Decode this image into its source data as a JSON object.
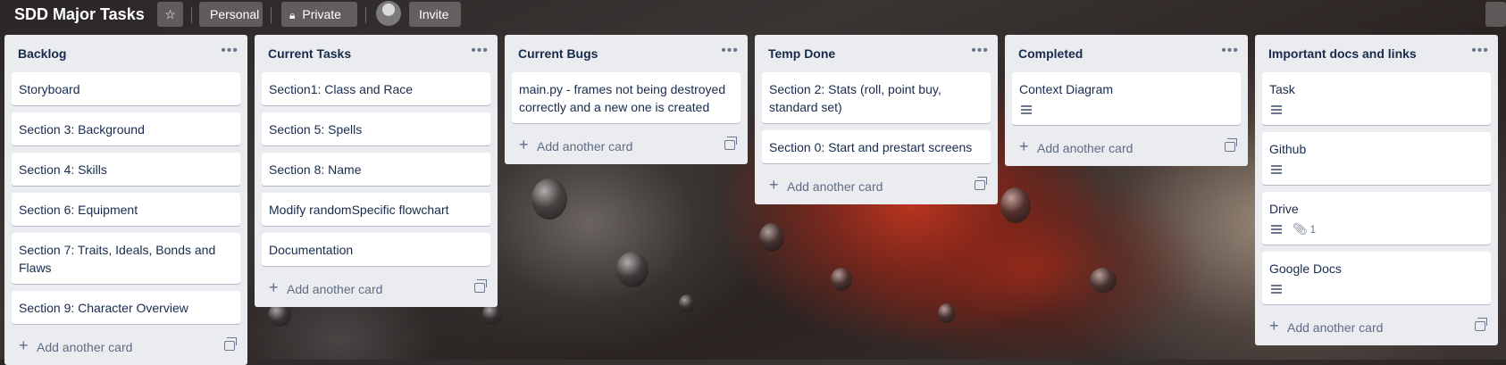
{
  "board": {
    "title": "SDD Major Tasks",
    "visibility_team": "Personal",
    "visibility_privacy": "Private",
    "invite_label": "Invite"
  },
  "add_card_label": "Add another card",
  "lists": [
    {
      "title": "Backlog",
      "cards": [
        {
          "title": "Storyboard"
        },
        {
          "title": "Section 3: Background"
        },
        {
          "title": "Section 4: Skills"
        },
        {
          "title": "Section 6: Equipment"
        },
        {
          "title": "Section 7: Traits, Ideals, Bonds and Flaws"
        },
        {
          "title": "Section 9: Character Overview"
        }
      ]
    },
    {
      "title": "Current Tasks",
      "cards": [
        {
          "title": "Section1: Class and Race"
        },
        {
          "title": "Section 5: Spells"
        },
        {
          "title": "Section 8: Name"
        },
        {
          "title": "Modify randomSpecific flowchart"
        },
        {
          "title": "Documentation"
        }
      ]
    },
    {
      "title": "Current Bugs",
      "cards": [
        {
          "title": "main.py - frames not being destroyed correctly and a new one is created"
        }
      ]
    },
    {
      "title": "Temp Done",
      "cards": [
        {
          "title": "Section 2: Stats (roll, point buy, standard set)"
        },
        {
          "title": "Section 0: Start and prestart screens"
        }
      ]
    },
    {
      "title": "Completed",
      "cards": [
        {
          "title": "Context Diagram",
          "has_description": true
        }
      ]
    },
    {
      "title": "Important docs and links",
      "cards": [
        {
          "title": "Task",
          "has_description": true
        },
        {
          "title": "Github",
          "has_description": true
        },
        {
          "title": "Drive",
          "has_description": true,
          "attachments": "1"
        },
        {
          "title": "Google Docs",
          "has_description": true
        }
      ]
    }
  ]
}
